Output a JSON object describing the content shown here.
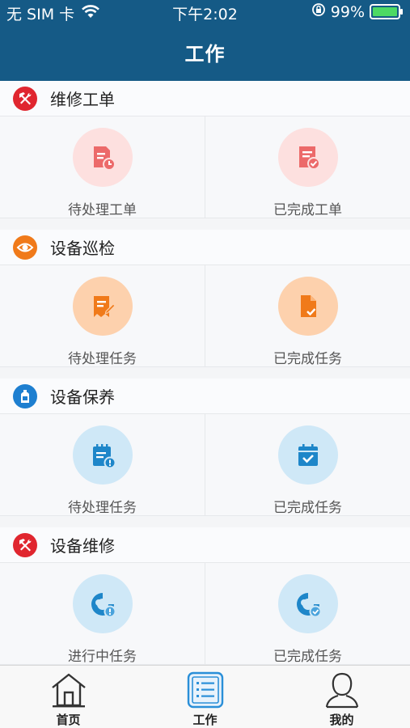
{
  "status_bar": {
    "carrier": "无 SIM 卡",
    "time": "下午2:02",
    "battery_percent": "99%",
    "battery_level": 0.99
  },
  "nav": {
    "title": "工作"
  },
  "sections": [
    {
      "title": "维修工单",
      "icon": "hammer-wrench-icon",
      "icon_color": "#e0262f",
      "items": [
        {
          "label": "待处理工单",
          "icon": "pending-order-icon"
        },
        {
          "label": "已完成工单",
          "icon": "completed-order-icon"
        }
      ]
    },
    {
      "title": "设备巡检",
      "icon": "eye-icon",
      "icon_color": "#f07a1a",
      "items": [
        {
          "label": "待处理任务",
          "icon": "pending-inspection-icon"
        },
        {
          "label": "已完成任务",
          "icon": "completed-inspection-icon"
        }
      ]
    },
    {
      "title": "设备保养",
      "icon": "oil-bottle-icon",
      "icon_color": "#1e7fd0",
      "items": [
        {
          "label": "待处理任务",
          "icon": "pending-maintenance-icon"
        },
        {
          "label": "已完成任务",
          "icon": "completed-maintenance-icon"
        }
      ]
    },
    {
      "title": "设备维修",
      "icon": "hammer-wrench-icon",
      "icon_color": "#e0262f",
      "items": [
        {
          "label": "进行中任务",
          "icon": "repair-in-progress-icon"
        },
        {
          "label": "已完成任务",
          "icon": "repair-completed-icon"
        }
      ]
    }
  ],
  "tabbar": {
    "items": [
      {
        "label": "首页",
        "icon": "home-icon"
      },
      {
        "label": "工作",
        "icon": "work-list-icon",
        "active": true
      },
      {
        "label": "我的",
        "icon": "profile-icon"
      }
    ]
  },
  "colors": {
    "header": "#155a86",
    "red_tint": "#fde0df",
    "red_icon": "#ec6a6a",
    "orange_tint": "#fdd1ad",
    "orange_icon": "#f07a1a",
    "blue_tint": "#cfe8f7",
    "blue_icon": "#1e86c9",
    "active_tab": "#2a8fd8"
  }
}
